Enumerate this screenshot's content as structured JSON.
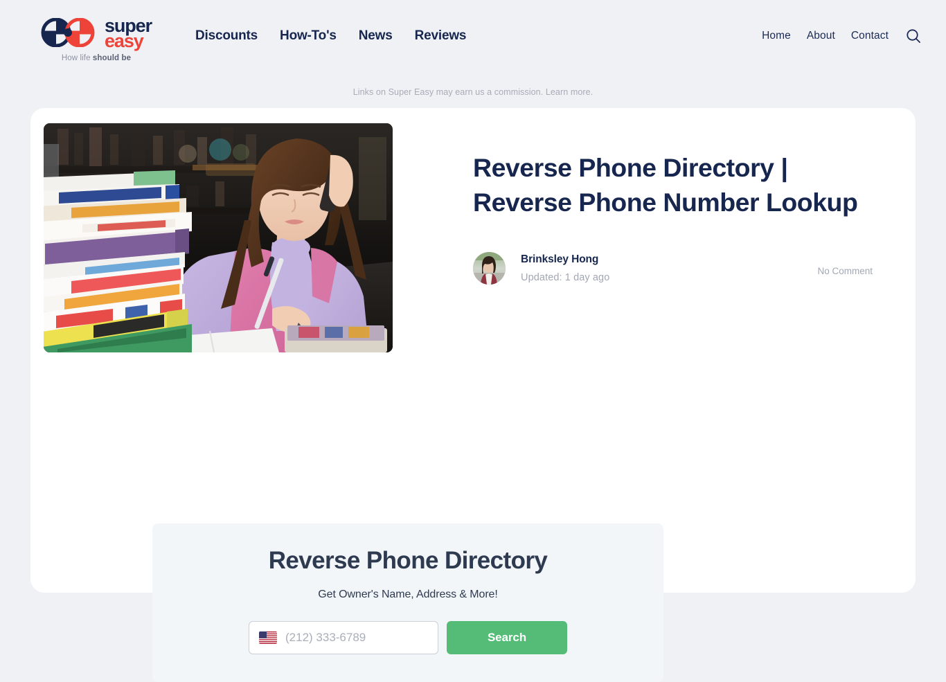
{
  "brand": {
    "logo_icon": "superasy-double-e-logo",
    "name_line1": "super",
    "name_line2": "easy",
    "tagline_prefix": "How life ",
    "tagline_bold": "should be",
    "navy": "#16264E",
    "red": "#EE4338"
  },
  "nav": {
    "main": [
      {
        "label": "Discounts"
      },
      {
        "label": "How-To's"
      },
      {
        "label": "News"
      },
      {
        "label": "Reviews"
      }
    ],
    "utility": [
      {
        "label": "Home"
      },
      {
        "label": "About"
      },
      {
        "label": "Contact"
      }
    ],
    "search_icon": "search-icon"
  },
  "disclaimer": {
    "text": "Links on Super Easy may earn us a commission.",
    "link_label": "Learn more."
  },
  "article": {
    "hero_image_alt": "Woman on phone writing notes beside a tall stack of colorful books",
    "title": "Reverse Phone Directory | Reverse Phone Number Lookup",
    "author": "Brinksley Hong",
    "updated": "Updated: 1 day ago",
    "comments": "No Comment"
  },
  "widget": {
    "title": "Reverse Phone Directory",
    "subtitle": "Get Owner's Name, Address & More!",
    "flag_icon": "us-flag-icon",
    "phone_placeholder": "(212) 333-6789",
    "phone_value": "",
    "search_label": "Search",
    "button_color": "#55BC77"
  },
  "page": {
    "background": "#F0F1F5",
    "card_background": "#FFFFFF",
    "widget_background": "#F3F6F9"
  }
}
